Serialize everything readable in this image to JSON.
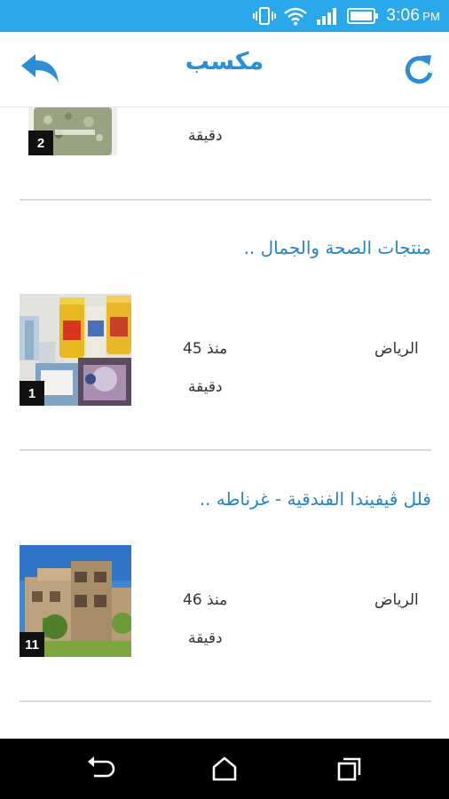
{
  "status_bar": {
    "time": "3:06",
    "ampm": "PM"
  },
  "app_bar": {
    "title": "مكسب"
  },
  "listings": [
    {
      "meta_line2": "دقيقة",
      "photo_count": "2"
    },
    {
      "title": "منتجات الصحة والجمال ..",
      "city": "الرياض",
      "time_ago": "منذ 45",
      "meta_line2": "دقيقة",
      "photo_count": "1"
    },
    {
      "title": "فلل ڤيفيندا الفندقية - غرناطه ..",
      "city": "الرياض",
      "time_ago": "منذ 46",
      "meta_line2": "دقيقة",
      "photo_count": "11"
    }
  ],
  "icons": {
    "back": "back-arrow-icon",
    "refresh": "refresh-icon",
    "nav_back": "nav-back-icon",
    "nav_home": "nav-home-icon",
    "nav_recents": "nav-recents-icon"
  },
  "colors": {
    "status_bar": "#2aa8ec",
    "accent": "#2a8fd4",
    "title_link": "#2386c9",
    "nav_bar": "#000000"
  }
}
